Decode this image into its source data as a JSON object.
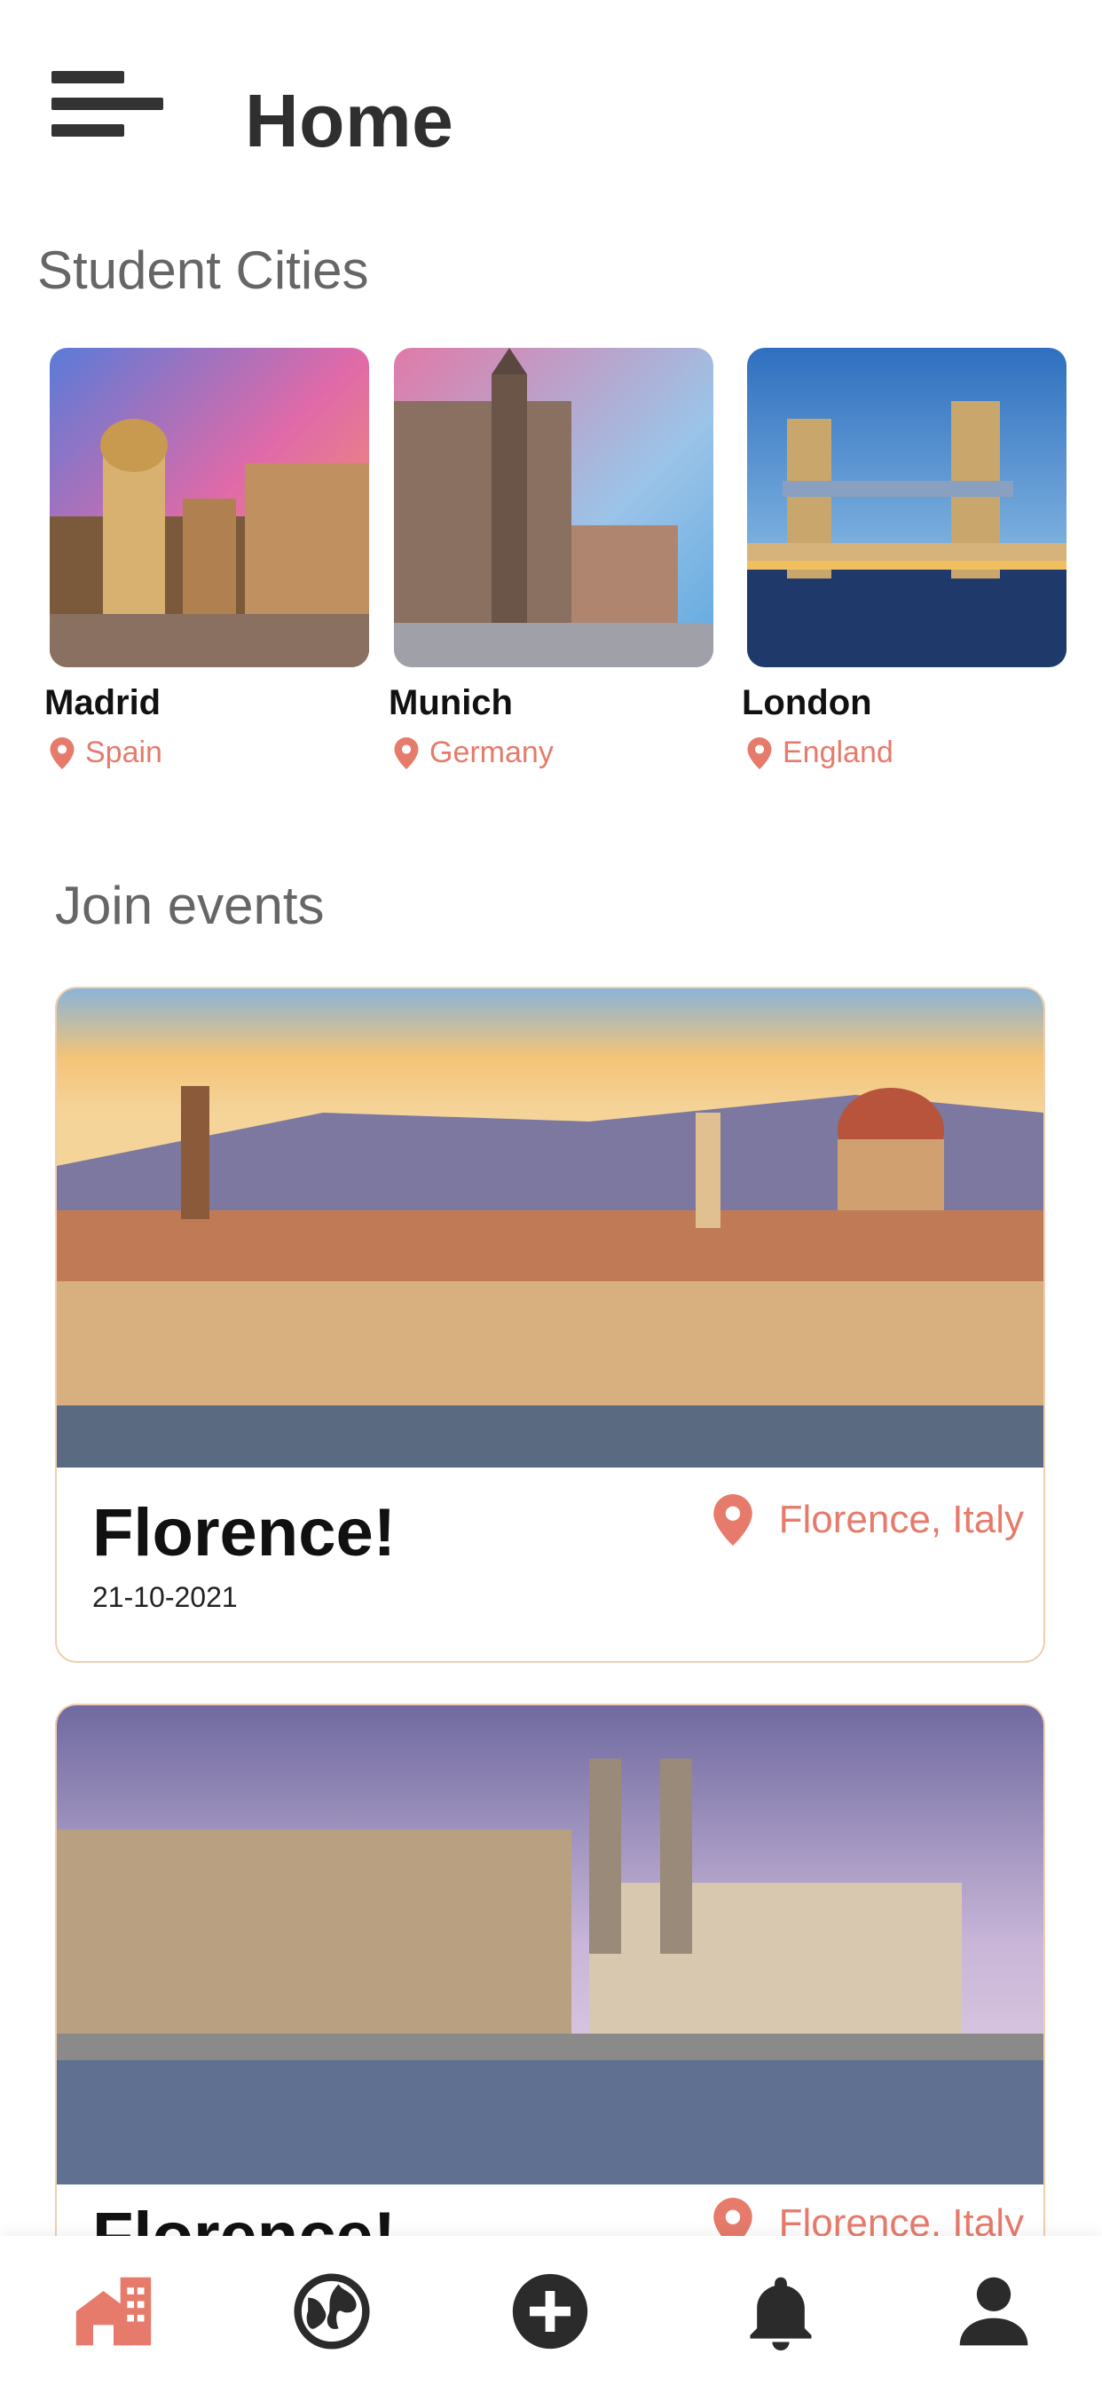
{
  "header": {
    "title": "Home",
    "menu_icon": "menu-icon"
  },
  "student_cities": {
    "section_title": "Student Cities",
    "cities": [
      {
        "name": "Madrid",
        "country": "Spain"
      },
      {
        "name": "Munich",
        "country": "Germany"
      },
      {
        "name": "London",
        "country": "England"
      }
    ]
  },
  "events": {
    "section_title": "Join events",
    "items": [
      {
        "title": "Florence!",
        "date": "21-10-2021",
        "location": "Florence, Italy"
      },
      {
        "title": "Florence!",
        "date": "",
        "location": "Florence, Italy"
      }
    ]
  },
  "bottom_nav": {
    "items": [
      {
        "icon": "home-icon",
        "active": true
      },
      {
        "icon": "globe-icon",
        "active": false
      },
      {
        "icon": "add-circle-icon",
        "active": false
      },
      {
        "icon": "bell-icon",
        "active": false
      },
      {
        "icon": "profile-icon",
        "active": false
      }
    ]
  },
  "colors": {
    "accent": "#e67b6b",
    "text_dark": "#2f2f2f",
    "card_border": "#efcfb0"
  }
}
